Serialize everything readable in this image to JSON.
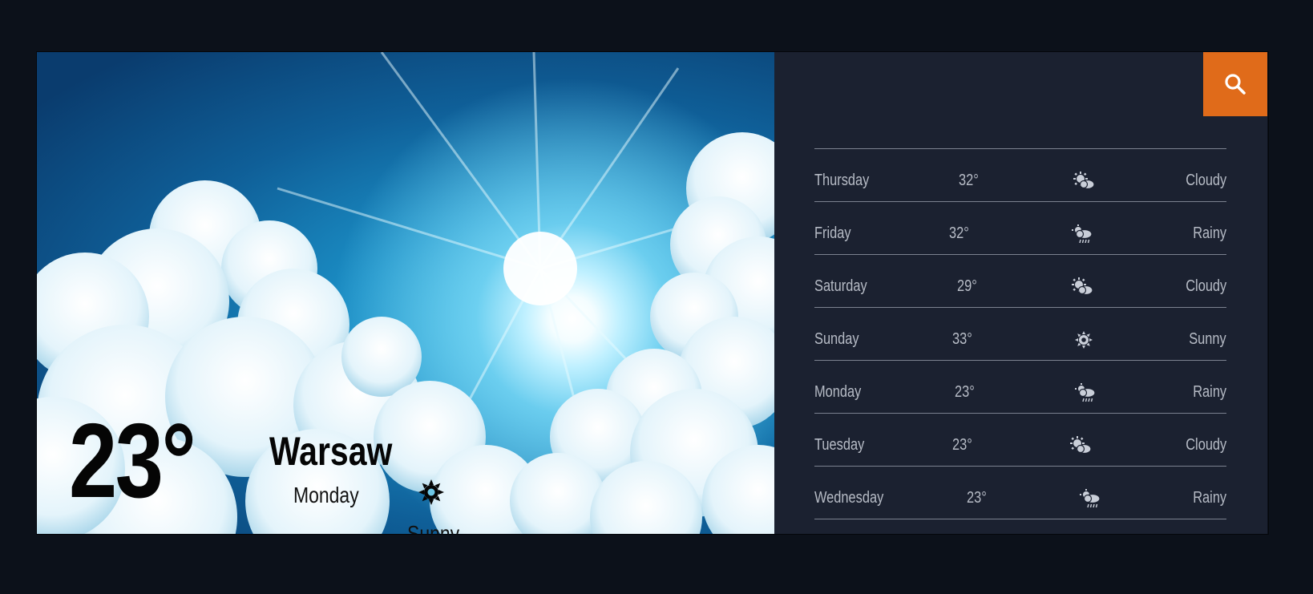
{
  "current": {
    "temperature": "23°",
    "city": "Warsaw",
    "day": "Monday",
    "condition": "Sunny",
    "condition_icon": "sun-icon"
  },
  "search": {
    "icon": "search-icon",
    "accent_color": "#e06b1a"
  },
  "forecast": [
    {
      "day": "Thursday",
      "temp": "32°",
      "icon": "partly-cloudy-icon",
      "condition": "Cloudy"
    },
    {
      "day": "Friday",
      "temp": "32°",
      "icon": "rain-cloud-icon",
      "condition": "Rainy"
    },
    {
      "day": "Saturday",
      "temp": "29°",
      "icon": "partly-cloudy-icon",
      "condition": "Cloudy"
    },
    {
      "day": "Sunday",
      "temp": "33°",
      "icon": "sun-icon",
      "condition": "Sunny"
    },
    {
      "day": "Monday",
      "temp": "23°",
      "icon": "rain-cloud-icon",
      "condition": "Rainy"
    },
    {
      "day": "Tuesday",
      "temp": "23°",
      "icon": "partly-cloudy-icon",
      "condition": "Cloudy"
    },
    {
      "day": "Wednesday",
      "temp": "23°",
      "icon": "rain-cloud-icon",
      "condition": "Rainy"
    }
  ]
}
